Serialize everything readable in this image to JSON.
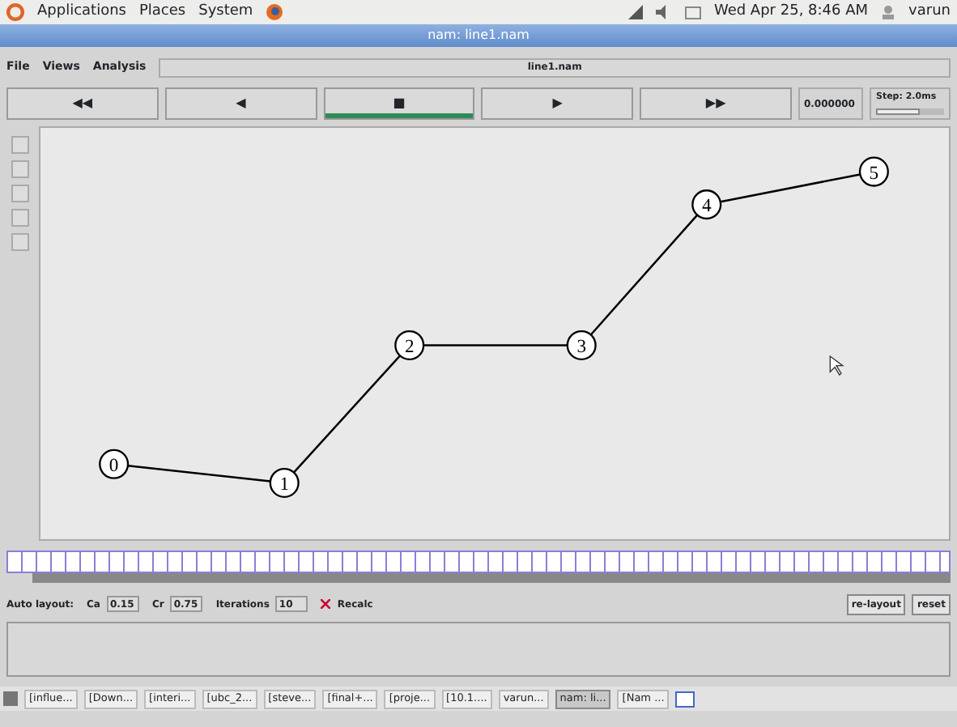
{
  "top_panel": {
    "menus": [
      "Applications",
      "Places",
      "System"
    ],
    "clock": "Wed Apr 25, 8:46 AM",
    "user": "varun"
  },
  "window": {
    "title": "nam: line1.nam"
  },
  "menu": [
    "File",
    "Views",
    "Analysis"
  ],
  "filename": "line1.nam",
  "playback": [
    {
      "symbol": "◀◀",
      "selected": false
    },
    {
      "symbol": "◀",
      "selected": false
    },
    {
      "symbol": "■",
      "selected": true
    },
    {
      "symbol": "▶",
      "selected": false
    },
    {
      "symbol": "▶▶",
      "selected": false
    }
  ],
  "time": "0.000000",
  "step": {
    "label": "Step: 2.0ms",
    "level": 0.65
  },
  "nodes": [
    {
      "label": "0"
    },
    {
      "label": "1"
    },
    {
      "label": "2"
    },
    {
      "label": "3"
    },
    {
      "label": "4"
    },
    {
      "label": "5"
    }
  ],
  "auto_layout": {
    "label": "Auto layout:",
    "fields": [
      {
        "label": "Ca",
        "value": "0.15"
      },
      {
        "label": "Cr",
        "value": "0.75"
      },
      {
        "label": "Iterations",
        "value": "10"
      }
    ],
    "recalc": {
      "label": "Recalc",
      "checked": true
    },
    "buttons": [
      "re-layout",
      "reset"
    ]
  },
  "taskbar": [
    {
      "label": "[influe...",
      "selected": false
    },
    {
      "label": "[Down...",
      "selected": false
    },
    {
      "label": "[interi...",
      "selected": false
    },
    {
      "label": "[ubc_2...",
      "selected": false
    },
    {
      "label": "[steve...",
      "selected": false
    },
    {
      "label": "[final+...",
      "selected": false
    },
    {
      "label": "[proje...",
      "selected": false
    },
    {
      "label": "[10.1....",
      "selected": false
    },
    {
      "label": "varun...",
      "selected": false
    },
    {
      "label": "nam: li...",
      "selected": true
    },
    {
      "label": "[Nam ...",
      "selected": false
    }
  ]
}
